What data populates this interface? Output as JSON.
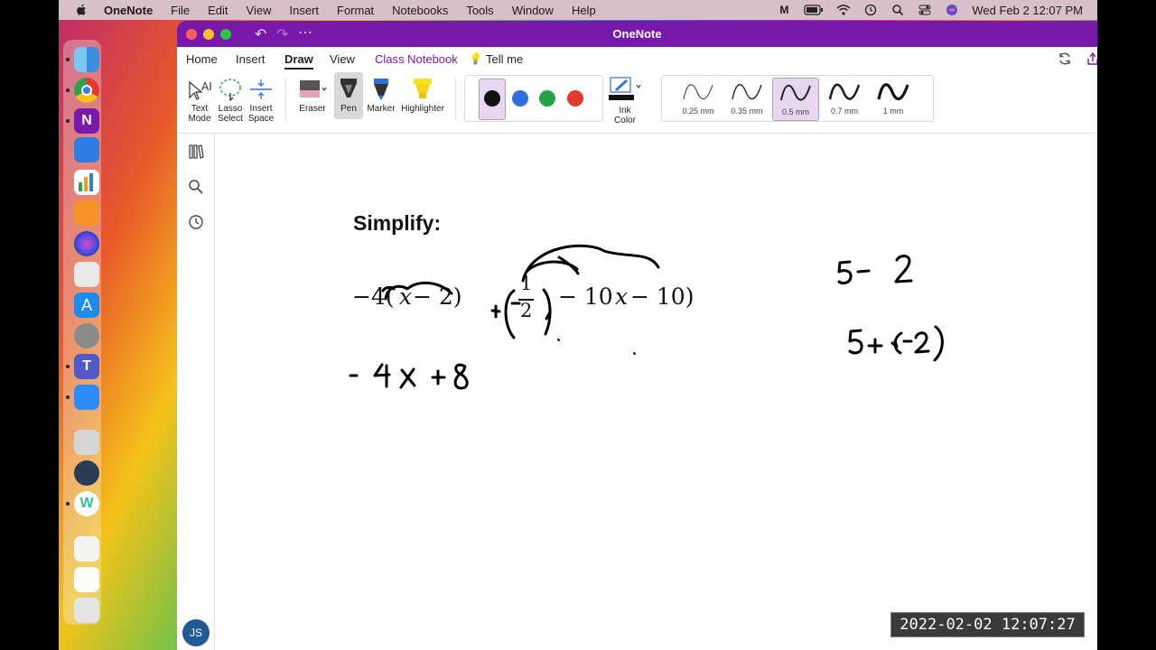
{
  "menubar": {
    "app": "OneNote",
    "items": [
      "File",
      "Edit",
      "View",
      "Insert",
      "Format",
      "Notebooks",
      "Tools",
      "Window",
      "Help"
    ],
    "clock": "Wed Feb 2  12:07 PM"
  },
  "window": {
    "title": "OneNote"
  },
  "tabs": {
    "home": "Home",
    "insert": "Insert",
    "draw": "Draw",
    "view": "View",
    "class_notebook": "Class Notebook",
    "tell_me": "Tell me"
  },
  "ribbon": {
    "text_mode": "Text\nMode",
    "lasso_select": "Lasso\nSelect",
    "insert_space": "Insert\nSpace",
    "eraser": "Eraser",
    "pen": "Pen",
    "marker": "Marker",
    "highlighter": "Highlighter",
    "ink_color": "Ink\nColor",
    "colors": [
      "#111111",
      "#2f6fde",
      "#22a34a",
      "#e23b2e"
    ],
    "thicknesses": [
      "0.25 mm",
      "0.35 mm",
      "0.5 mm",
      "0.7 mm",
      "1 mm"
    ],
    "selected_thickness": "0.5 mm"
  },
  "sidebar": {
    "avatar_initials": "JS"
  },
  "page": {
    "heading": "Simplify:",
    "expression": "−4(x − 2) + (−1/2)(−10x − 10)",
    "expr_parts": {
      "p1": "−4(",
      "x": "x",
      "p2": " − 2) ",
      "p3": "− 10",
      "x2": "x",
      "p4": " − 10)",
      "num": "1",
      "den": "2"
    }
  },
  "recording": {
    "timestamp": "2022-02-02  12:07:27"
  }
}
